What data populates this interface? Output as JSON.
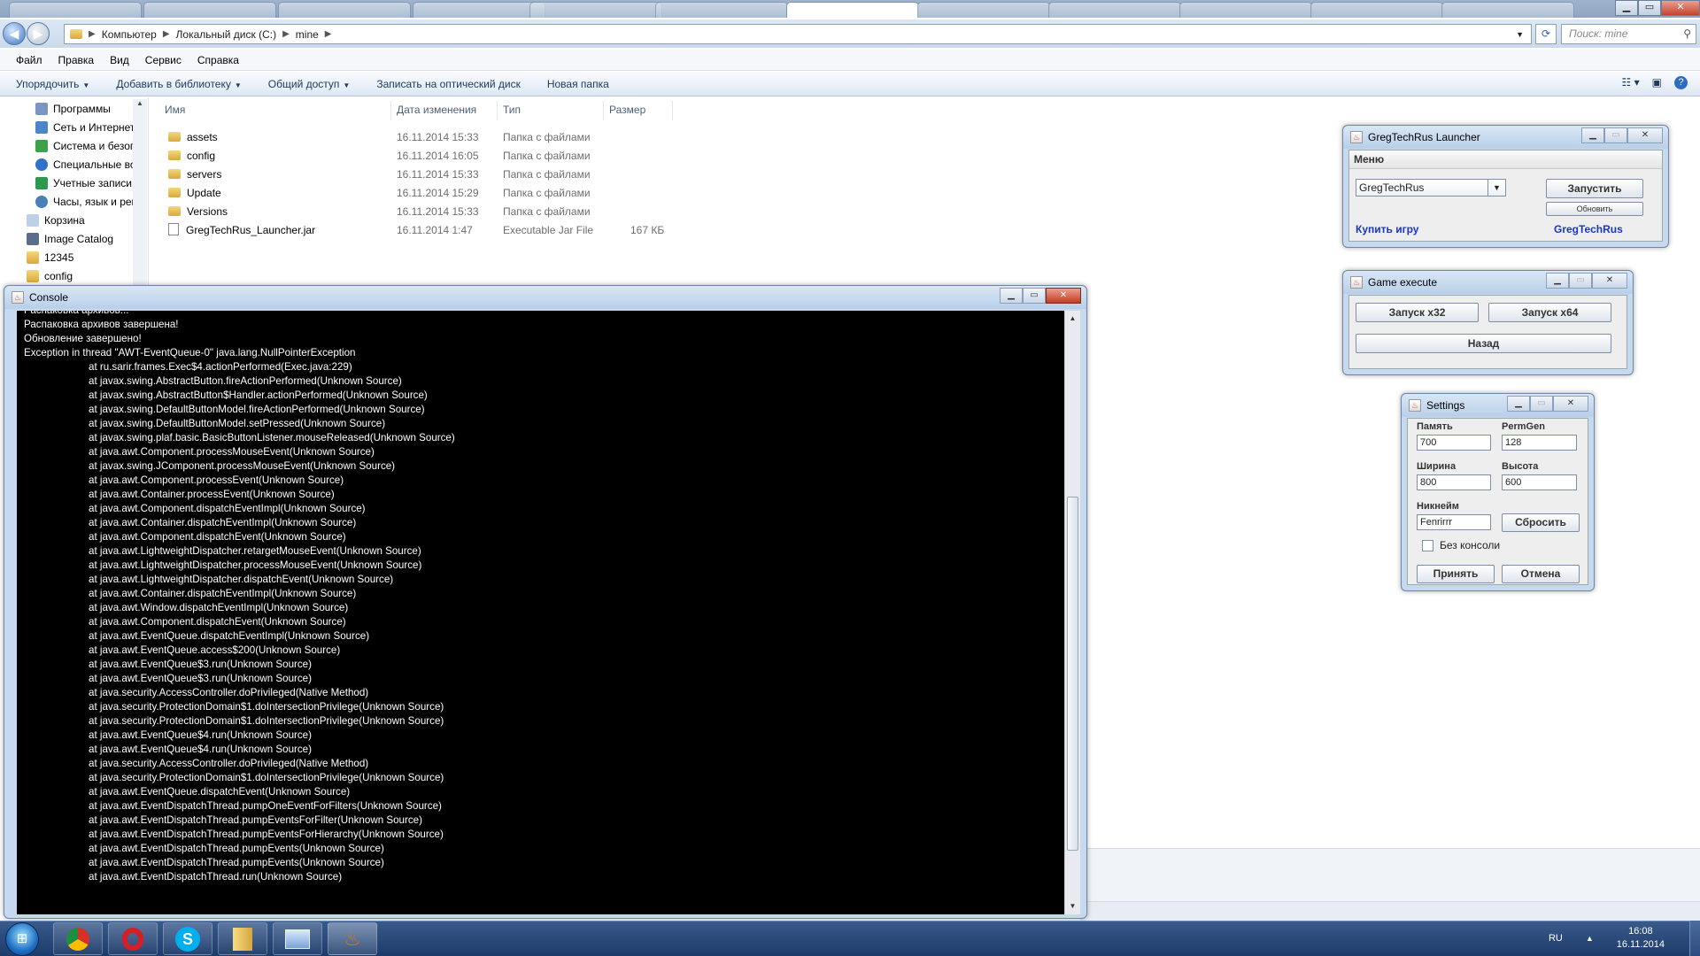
{
  "explorer": {
    "address_parts": [
      "Компьютер",
      "Локальный диск (C:)",
      "mine"
    ],
    "search_placeholder": "Поиск: mine",
    "menu": [
      "Файл",
      "Правка",
      "Вид",
      "Сервис",
      "Справка"
    ],
    "commands": [
      "Упорядочить",
      "Добавить в библиотеку",
      "Общий доступ",
      "Записать на оптический диск",
      "Новая папка"
    ],
    "nav_items": [
      "Программы",
      "Сеть и Интернет",
      "Система и безоп",
      "Специальные во",
      "Учетные записи",
      "Часы, язык и рег",
      "Корзина",
      "Image Catalog",
      "12345",
      "config"
    ],
    "columns": [
      "Имя",
      "Дата изменения",
      "Тип",
      "Размер"
    ],
    "files": [
      {
        "name": "assets",
        "date": "16.11.2014 15:33",
        "type": "Папка с файлами",
        "size": ""
      },
      {
        "name": "config",
        "date": "16.11.2014 16:05",
        "type": "Папка с файлами",
        "size": ""
      },
      {
        "name": "servers",
        "date": "16.11.2014 15:33",
        "type": "Папка с файлами",
        "size": ""
      },
      {
        "name": "Update",
        "date": "16.11.2014 15:29",
        "type": "Папка с файлами",
        "size": ""
      },
      {
        "name": "Versions",
        "date": "16.11.2014 15:33",
        "type": "Папка с файлами",
        "size": ""
      },
      {
        "name": "GregTechRus_Launcher.jar",
        "date": "16.11.2014 1:47",
        "type": "Executable Jar File",
        "size": "167 КБ"
      }
    ]
  },
  "console": {
    "title": "Console",
    "lines": [
      "Распаковка архивов...",
      "Распаковка архивов завершена!",
      "Обновление завершено!",
      "Exception in thread \"AWT-EventQueue-0\" java.lang.NullPointerException"
    ],
    "stack": [
      "at ru.sarir.frames.Exec$4.actionPerformed(Exec.java:229)",
      "at javax.swing.AbstractButton.fireActionPerformed(Unknown Source)",
      "at javax.swing.AbstractButton$Handler.actionPerformed(Unknown Source)",
      "at javax.swing.DefaultButtonModel.fireActionPerformed(Unknown Source)",
      "at javax.swing.DefaultButtonModel.setPressed(Unknown Source)",
      "at javax.swing.plaf.basic.BasicButtonListener.mouseReleased(Unknown Source)",
      "at java.awt.Component.processMouseEvent(Unknown Source)",
      "at javax.swing.JComponent.processMouseEvent(Unknown Source)",
      "at java.awt.Component.processEvent(Unknown Source)",
      "at java.awt.Container.processEvent(Unknown Source)",
      "at java.awt.Component.dispatchEventImpl(Unknown Source)",
      "at java.awt.Container.dispatchEventImpl(Unknown Source)",
      "at java.awt.Component.dispatchEvent(Unknown Source)",
      "at java.awt.LightweightDispatcher.retargetMouseEvent(Unknown Source)",
      "at java.awt.LightweightDispatcher.processMouseEvent(Unknown Source)",
      "at java.awt.LightweightDispatcher.dispatchEvent(Unknown Source)",
      "at java.awt.Container.dispatchEventImpl(Unknown Source)",
      "at java.awt.Window.dispatchEventImpl(Unknown Source)",
      "at java.awt.Component.dispatchEvent(Unknown Source)",
      "at java.awt.EventQueue.dispatchEventImpl(Unknown Source)",
      "at java.awt.EventQueue.access$200(Unknown Source)",
      "at java.awt.EventQueue$3.run(Unknown Source)",
      "at java.awt.EventQueue$3.run(Unknown Source)",
      "at java.security.AccessController.doPrivileged(Native Method)",
      "at java.security.ProtectionDomain$1.doIntersectionPrivilege(Unknown Source)",
      "at java.security.ProtectionDomain$1.doIntersectionPrivilege(Unknown Source)",
      "at java.awt.EventQueue$4.run(Unknown Source)",
      "at java.awt.EventQueue$4.run(Unknown Source)",
      "at java.security.AccessController.doPrivileged(Native Method)",
      "at java.security.ProtectionDomain$1.doIntersectionPrivilege(Unknown Source)",
      "at java.awt.EventQueue.dispatchEvent(Unknown Source)",
      "at java.awt.EventDispatchThread.pumpOneEventForFilters(Unknown Source)",
      "at java.awt.EventDispatchThread.pumpEventsForFilter(Unknown Source)",
      "at java.awt.EventDispatchThread.pumpEventsForHierarchy(Unknown Source)",
      "at java.awt.EventDispatchThread.pumpEvents(Unknown Source)",
      "at java.awt.EventDispatchThread.pumpEvents(Unknown Source)",
      "at java.awt.EventDispatchThread.run(Unknown Source)"
    ]
  },
  "launcher": {
    "title": "GregTechRus Launcher",
    "menu": "Меню",
    "server_selected": "GregTechRus",
    "launch": "Запустить",
    "update": "Обновить",
    "buy": "Купить игру",
    "site": "GregTechRus"
  },
  "game_execute": {
    "title": "Game execute",
    "x32": "Запуск x32",
    "x64": "Запуск x64",
    "back": "Назад"
  },
  "settings": {
    "title": "Settings",
    "memory_label": "Память",
    "memory": "700",
    "permgen_label": "PermGen",
    "permgen": "128",
    "width_label": "Ширина",
    "width": "800",
    "height_label": "Высота",
    "height": "600",
    "nick_label": "Никнейм",
    "nick": "Fenrirrr",
    "reset": "Сбросить",
    "no_console": "Без консоли",
    "apply": "Принять",
    "cancel": "Отмена"
  },
  "taskbar": {
    "lang": "RU",
    "time": "16:08",
    "date": "16.11.2014"
  },
  "colors": {
    "console_bg": "#000000",
    "console_fg": "#ffffff",
    "link": "#1a35c8",
    "taskbar": "#1d3b6a"
  }
}
